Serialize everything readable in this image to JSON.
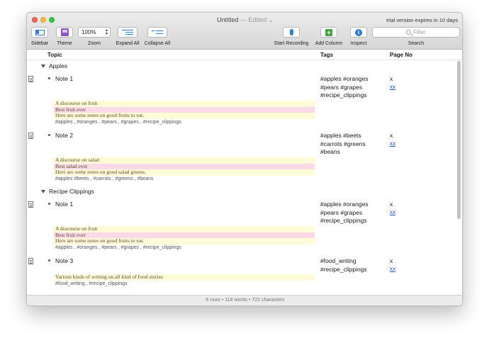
{
  "window": {
    "title": "Untitled",
    "edited": "— Edited ⌄",
    "trial": "trial version expires in 10 days"
  },
  "toolbar": {
    "sidebar_label": "Sidebar",
    "theme_label": "Theme",
    "zoom_value": "100%",
    "zoom_label": "Zoom",
    "expand_label": "Expand All",
    "collapse_label": "Collapse All",
    "recording_label": "Start Recording",
    "addcol_label": "Add Column",
    "inspect_label": "Inspect",
    "search_placeholder": "Filter",
    "search_label": "Search"
  },
  "columns": {
    "topic": "Topic",
    "tags": "Tags",
    "page": "Page No"
  },
  "groups": [
    {
      "name": "Apples",
      "notes": [
        {
          "title": "Note 1",
          "tags": [
            "#apples #oranges",
            "#pears #grapes",
            "#recipe_clippings"
          ],
          "page": "x",
          "link": "xx",
          "body": [
            {
              "text": "A discourse on fruit",
              "hl": "y"
            },
            {
              "text": "Best fruit ever",
              "hl": "p"
            },
            {
              "text": "Here are some notes on good fruits to eat.",
              "hl": "y"
            }
          ],
          "body_tags": "#apples , #oranges , #pears , #grapes ,  #recipe_clippings"
        },
        {
          "title": "Note 2",
          "tags": [
            "#apples #beets",
            "#carrots  #greens",
            "#beans"
          ],
          "page": "x",
          "link": "xx",
          "body": [
            {
              "text": "A discourse on salad",
              "hl": "y"
            },
            {
              "text": "Best salad ever",
              "hl": "p"
            },
            {
              "text": "Here are some notes on good salad greens.",
              "hl": "y"
            }
          ],
          "body_tags": "#apples #beets , #carrots , #greens , #beans"
        }
      ]
    },
    {
      "name": "Recipe Clippings",
      "notes": [
        {
          "title": "Note 1",
          "tags": [
            "#apples #oranges",
            "#pears #grapes",
            "#recipe_clippings"
          ],
          "page": "x",
          "link": "xx",
          "body": [
            {
              "text": "A discourse on fruit",
              "hl": "y"
            },
            {
              "text": "Best fruit ever",
              "hl": "p"
            },
            {
              "text": "Here are some notes on good fruits to eat.",
              "hl": "y"
            }
          ],
          "body_tags": "#apples , #oranges , #pears , #grapes ,  #recipe_clippings"
        },
        {
          "title": "Note 3",
          "tags": [
            "#food_writing",
            "#recipe_clippings"
          ],
          "page": "x",
          "link": "xx",
          "body": [
            {
              "text": "Various kinds of writing on all kind of food stories",
              "hl": "y"
            }
          ],
          "body_tags": "#food_writing , #recipe_clippings"
        }
      ]
    }
  ],
  "status": "6 rows • 118 words • 722 characters"
}
